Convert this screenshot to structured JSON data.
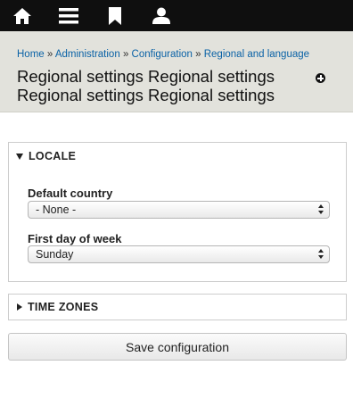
{
  "toolbar": {
    "icons": [
      "home-icon",
      "menu-icon",
      "bookmark-icon",
      "user-icon"
    ]
  },
  "breadcrumb": {
    "items": [
      "Home",
      "Administration",
      "Configuration",
      "Regional and language"
    ],
    "separator": "»"
  },
  "page": {
    "title": "Regional settings Regional settings Regional settings Regional settings"
  },
  "locale": {
    "legend": "LOCALE",
    "default_country": {
      "label": "Default country",
      "value": "- None -"
    },
    "first_day": {
      "label": "First day of week",
      "value": "Sunday"
    }
  },
  "time_zones": {
    "legend": "TIME ZONES"
  },
  "actions": {
    "save_label": "Save configuration"
  },
  "colors": {
    "toolbar_bg": "#0f0f0f",
    "header_bg": "#e2e2dc",
    "link": "#0a62a6"
  }
}
